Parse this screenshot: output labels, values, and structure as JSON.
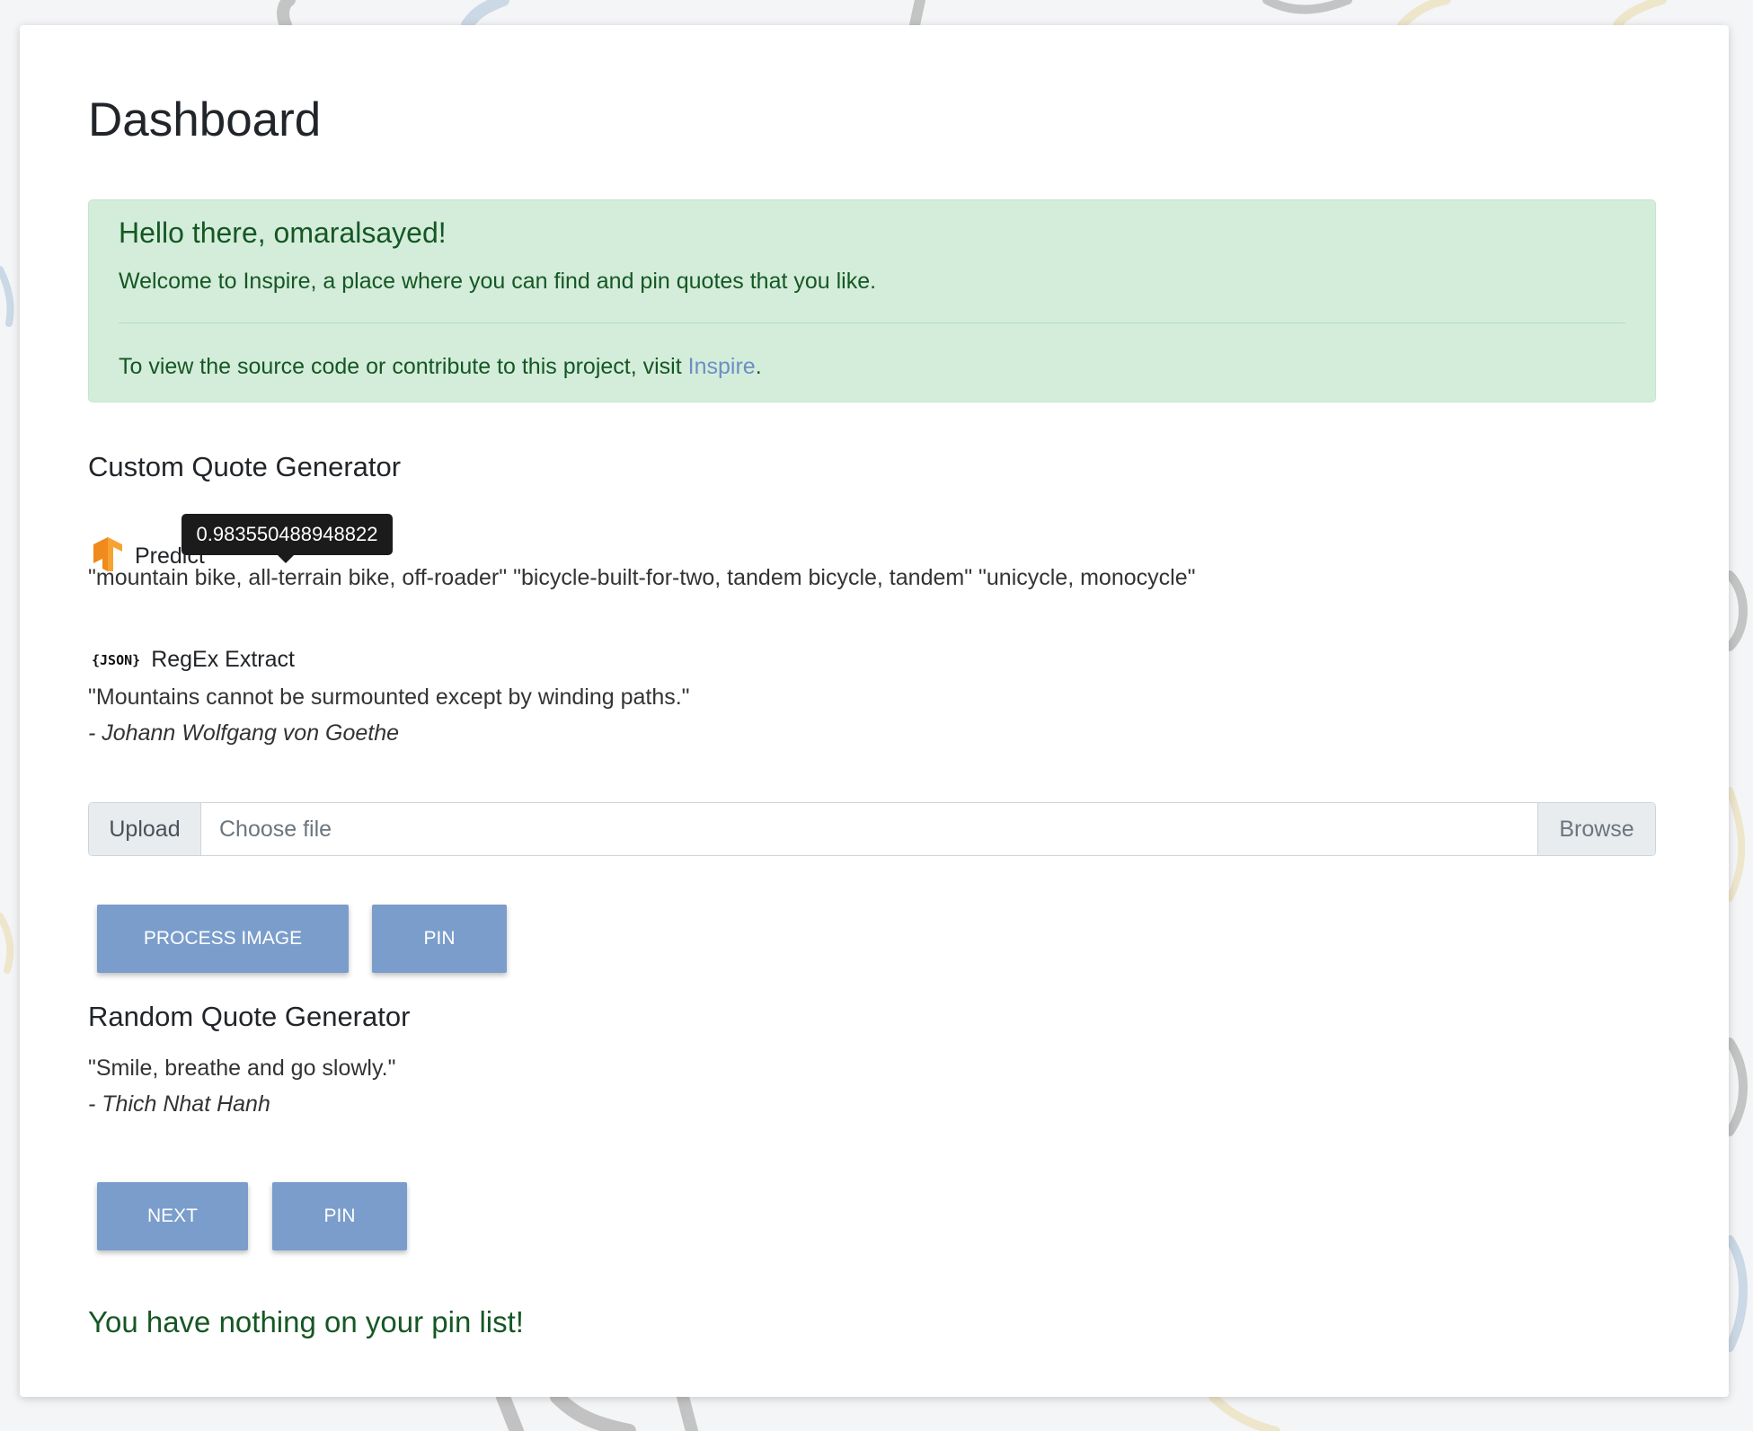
{
  "page": {
    "title": "Dashboard"
  },
  "alert": {
    "heading": "Hello there, omaralsayed!",
    "text": "Welcome to Inspire, a place where you can find and pin quotes that you like.",
    "footer_prefix": "To view the source code or contribute to this project, visit ",
    "footer_link": "Inspire",
    "footer_suffix": "."
  },
  "custom_generator": {
    "title": "Custom Quote Generator",
    "predict": {
      "icon": "tensorflow-icon",
      "label": "Predict",
      "tooltip": "0.983550488948822",
      "result": "\"mountain bike, all-terrain bike, off-roader\" \"bicycle-built-for-two, tandem bicycle, tandem\" \"unicycle, monocycle\""
    },
    "regex": {
      "icon": "json-icon",
      "icon_text": "{JSON}",
      "label": "RegEx Extract",
      "quote": "\"Mountains cannot be surmounted except by winding paths.\"",
      "author": "- Johann Wolfgang von Goethe"
    },
    "upload": {
      "prepend": "Upload",
      "placeholder": "Choose file",
      "browse": "Browse"
    },
    "buttons": {
      "process": "PROCESS IMAGE",
      "pin": "PIN"
    }
  },
  "random_generator": {
    "title": "Random Quote Generator",
    "quote": "\"Smile, breathe and go slowly.\"",
    "author": "- Thich Nhat Hanh",
    "buttons": {
      "next": "NEXT",
      "pin": "PIN"
    }
  },
  "pin_list": {
    "empty_message": "You have nothing on your pin list!"
  },
  "colors": {
    "accent_button": "#7a9dcb",
    "alert_bg": "#d4edda",
    "alert_text": "#155724",
    "link": "#6c8fc4"
  }
}
